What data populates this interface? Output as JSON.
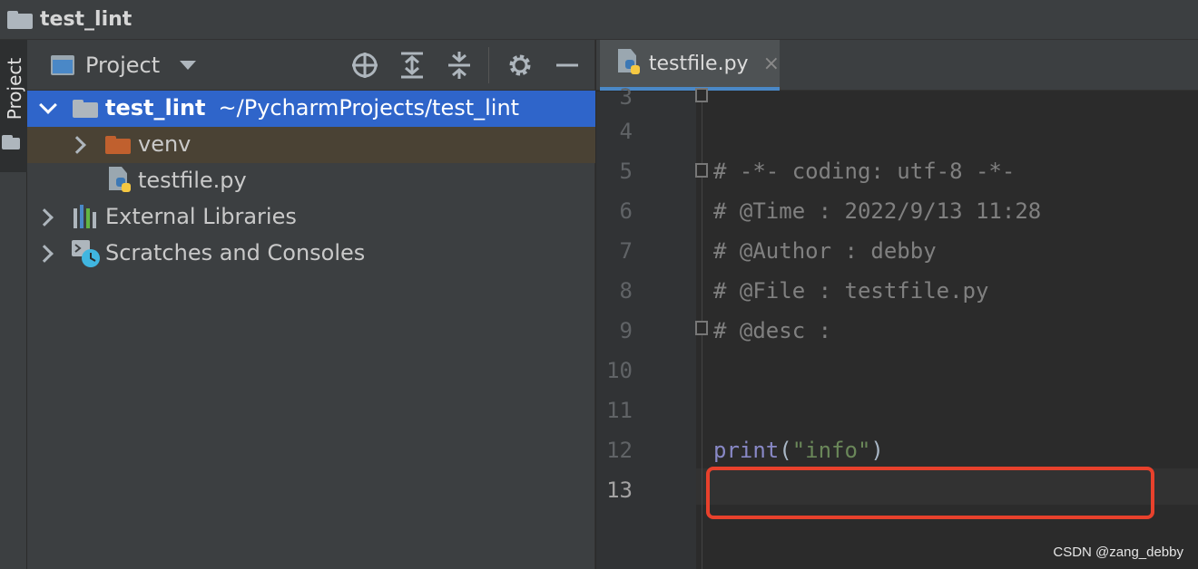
{
  "titlebar": {
    "crumb": "test_lint"
  },
  "strip": {
    "tab_label": "Project"
  },
  "project_panel": {
    "title": "Project",
    "tools": [
      "locate-icon",
      "expand-all-icon",
      "collapse-all-icon",
      "gear-icon",
      "minimize-icon"
    ]
  },
  "tree": {
    "root": {
      "name": "test_lint",
      "path": "~/PycharmProjects/test_lint"
    },
    "venv": {
      "name": "venv"
    },
    "file": {
      "name": "testfile.py"
    },
    "libs": {
      "name": "External Libraries"
    },
    "scratches": {
      "name": "Scratches and Consoles"
    }
  },
  "editor": {
    "tab_label": "testfile.py",
    "tab_close": "×",
    "lines": [
      {
        "num": "3",
        "text": ""
      },
      {
        "num": "4",
        "text": ""
      },
      {
        "num": "5",
        "text": "# -*- coding: utf-8 -*-"
      },
      {
        "num": "6",
        "text": "# @Time : 2022/9/13 11:28"
      },
      {
        "num": "7",
        "text": "# @Author : debby"
      },
      {
        "num": "8",
        "text": "# @File : testfile.py"
      },
      {
        "num": "9",
        "text": "# @desc :"
      },
      {
        "num": "10",
        "text": ""
      },
      {
        "num": "11",
        "text": ""
      },
      {
        "num": "12",
        "text": ""
      },
      {
        "num": "13",
        "text": ""
      }
    ],
    "print_line": {
      "kw": "print",
      "open": "(",
      "str": "\"info\"",
      "close": ")"
    }
  },
  "colors": {
    "accent": "#2f65ca",
    "highlight_box": "#e8412c",
    "string": "#6a8759",
    "builtin": "#8888c6"
  },
  "watermark": "CSDN @zang_debby"
}
